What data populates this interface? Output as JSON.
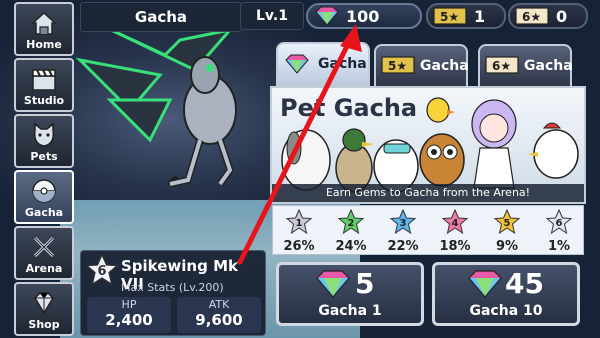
{
  "nav": {
    "items": [
      {
        "label": "Home",
        "icon": "home-icon"
      },
      {
        "label": "Studio",
        "icon": "clapperboard-icon"
      },
      {
        "label": "Pets",
        "icon": "cat-icon"
      },
      {
        "label": "Gacha",
        "icon": "capsule-icon",
        "active": true
      },
      {
        "label": "Arena",
        "icon": "crossed-swords-icon"
      },
      {
        "label": "Shop",
        "icon": "diamond-icon"
      }
    ]
  },
  "topbar": {
    "title": "Gacha",
    "level": "Lv.1",
    "gems": "100",
    "ticket5": "1",
    "ticket6": "0"
  },
  "tabs": [
    {
      "label": "Gacha",
      "icon": "gem-icon",
      "active": true
    },
    {
      "label": "Gacha",
      "icon": "ticket-5-star-icon"
    },
    {
      "label": "Gacha",
      "icon": "ticket-6-star-icon"
    }
  ],
  "banner": {
    "title": "Pet Gacha",
    "note": "Earn Gems to Gacha from the Arena!"
  },
  "rates": [
    {
      "star": "1",
      "pct": "26%"
    },
    {
      "star": "2",
      "pct": "24%"
    },
    {
      "star": "3",
      "pct": "22%"
    },
    {
      "star": "4",
      "pct": "18%"
    },
    {
      "star": "5",
      "pct": "9%"
    },
    {
      "star": "6",
      "pct": "1%"
    }
  ],
  "pull_buttons": [
    {
      "cost": "5",
      "label": "Gacha 1"
    },
    {
      "cost": "45",
      "label": "Gacha 10"
    }
  ],
  "pet": {
    "star": "6",
    "name": "Spikewing Mk VII",
    "max_stats": "Max Stats (Lv.200)",
    "hp_label": "HP",
    "hp": "2,400",
    "atk_label": "ATK",
    "atk": "9,600"
  },
  "colors": {
    "arrow": "#e8141b",
    "star1": "#c9c9d9",
    "star2": "#5fd36a",
    "star3": "#5cb6f0",
    "star4": "#f07aa6",
    "star5": "#f4c23a",
    "star6": "#e6e6f2"
  }
}
